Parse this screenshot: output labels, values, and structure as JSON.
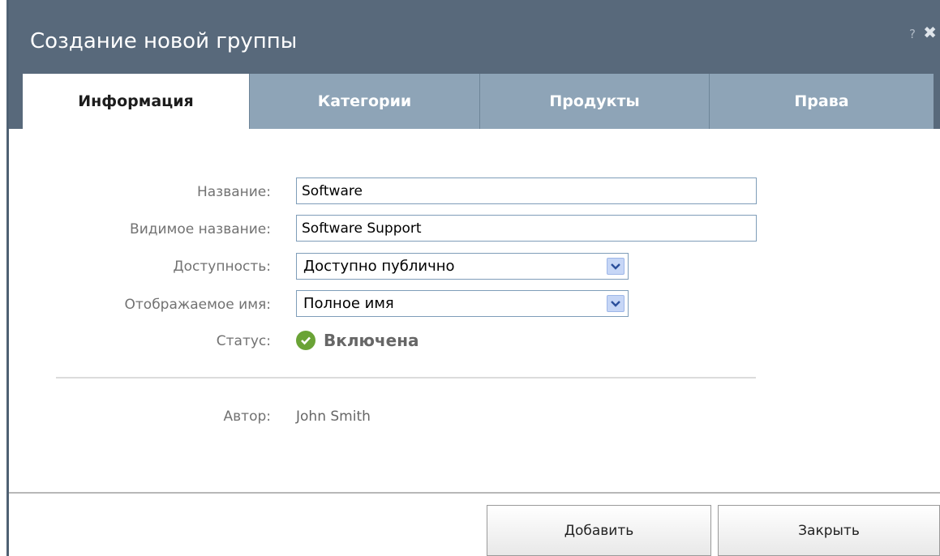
{
  "dialog": {
    "title": "Создание новой группы",
    "help_glyph": "?",
    "close_glyph": "✖"
  },
  "tabs": [
    {
      "label": "Информация",
      "active": true
    },
    {
      "label": "Категории",
      "active": false
    },
    {
      "label": "Продукты",
      "active": false
    },
    {
      "label": "Права",
      "active": false
    }
  ],
  "form": {
    "name_label": "Название:",
    "name_value": "Software",
    "visible_name_label": "Видимое название:",
    "visible_name_value": "Software Support",
    "availability_label": "Доступность:",
    "availability_value": "Доступно публично",
    "display_name_label": "Отображаемое имя:",
    "display_name_value": "Полное имя",
    "status_label": "Статус:",
    "status_value": "Включена",
    "author_label": "Автор:",
    "author_value": "John Smith"
  },
  "buttons": {
    "add_label": "Добавить",
    "close_label": "Закрыть"
  },
  "colors": {
    "titlebar": "#58697b",
    "tab_inactive": "#8ea4b7",
    "status_ok": "#6aa336"
  },
  "icons": {
    "help": "help-icon",
    "close": "close-icon",
    "dropdown": "chevron-down-icon",
    "status": "check-circle-icon"
  }
}
